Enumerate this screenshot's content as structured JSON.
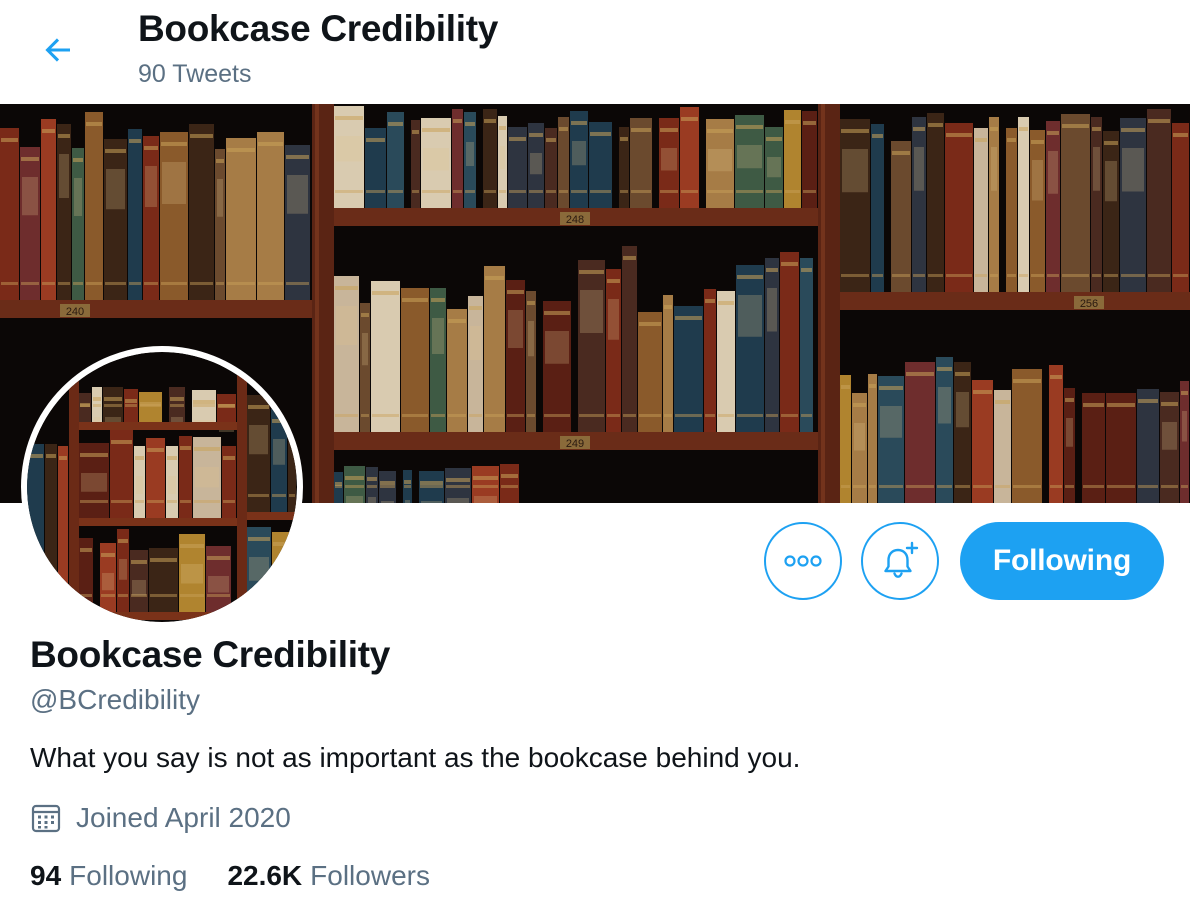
{
  "header": {
    "title": "Bookcase Credibility",
    "tweets_count": "90 Tweets",
    "back_icon": "arrow-left-icon"
  },
  "banner": {
    "shelf_labels": [
      "240",
      "248",
      "256",
      "249"
    ]
  },
  "actions": {
    "more_icon": "more-horizontal-icon",
    "notify_icon": "bell-plus-icon",
    "follow_label": "Following"
  },
  "profile": {
    "name": "Bookcase Credibility",
    "handle": "@BCredibility",
    "bio": "What you say is not as important as the bookcase behind you.",
    "joined_icon": "calendar-icon",
    "joined": "Joined April 2020",
    "following_count": "94",
    "following_label": "Following",
    "followers_count": "22.6K",
    "followers_label": "Followers"
  },
  "colors": {
    "accent": "#1da1f2",
    "secondary_text": "#5b7083",
    "primary_text": "#0f1419"
  }
}
